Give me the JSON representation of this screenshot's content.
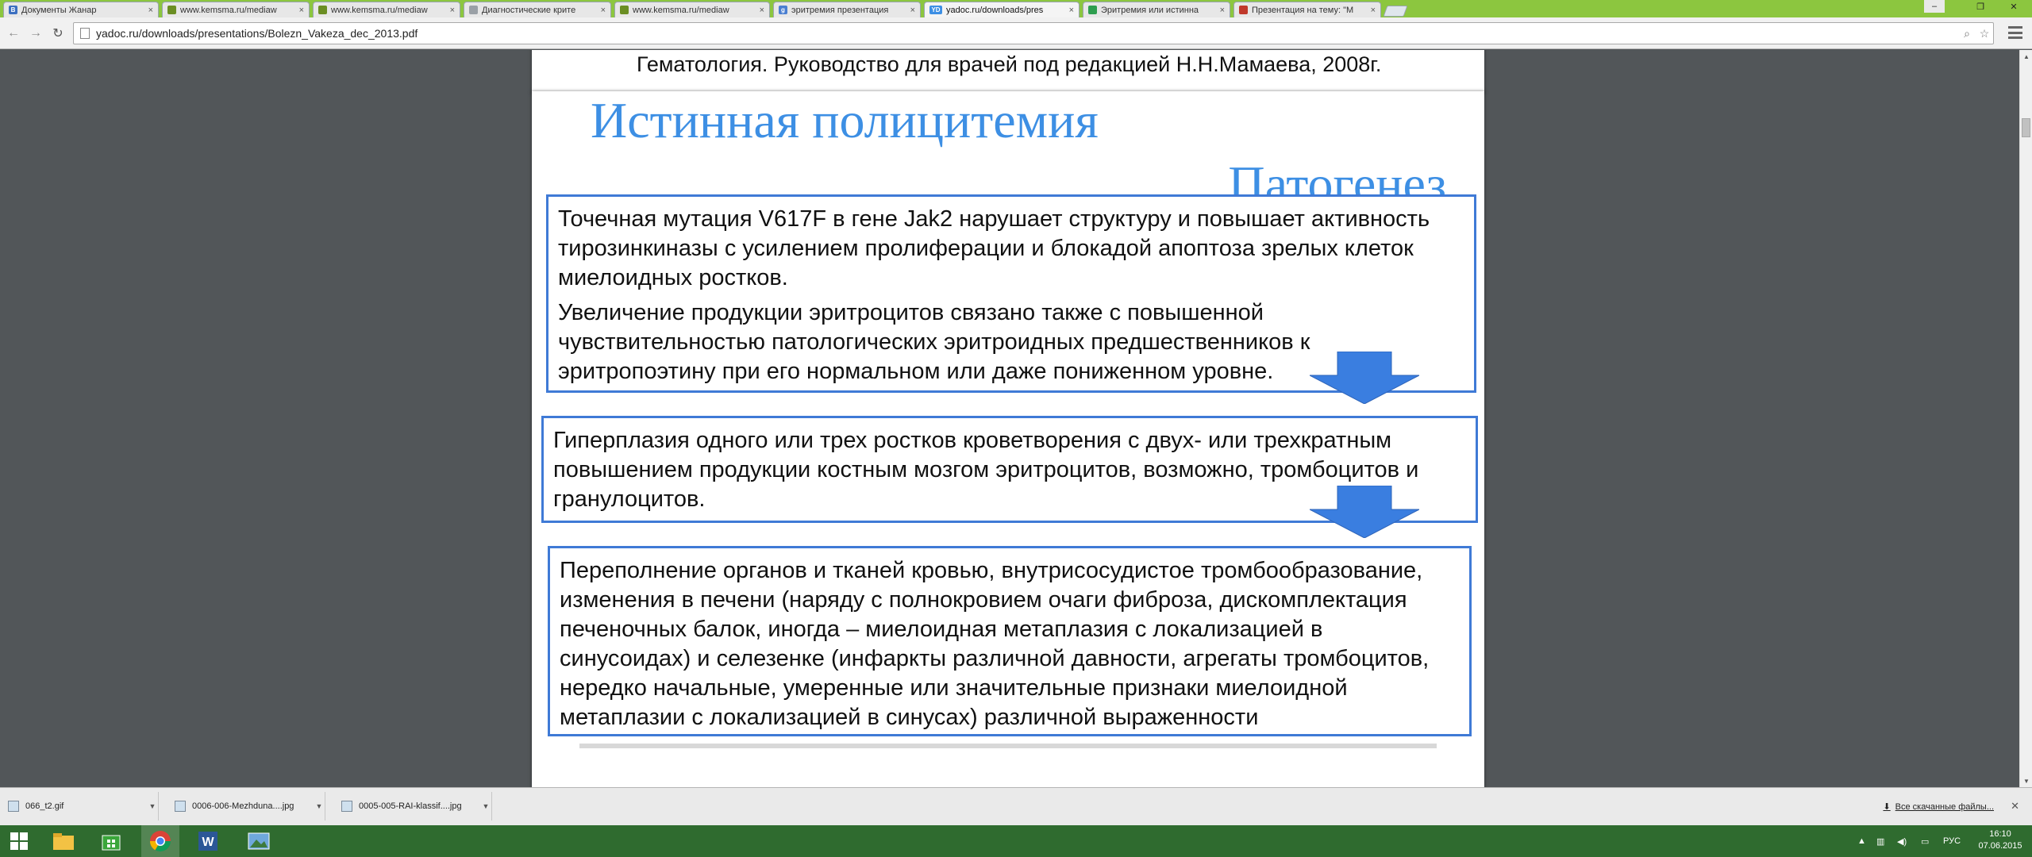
{
  "browser": {
    "tabs": [
      {
        "title": "Документы Жанар",
        "favicon_color": "#3b6fc0",
        "favicon_text": "В",
        "active": false
      },
      {
        "title": "www.kemsma.ru/mediaw",
        "favicon_color": "#6b8e23",
        "favicon_text": "",
        "active": false
      },
      {
        "title": "www.kemsma.ru/mediaw",
        "favicon_color": "#6b8e23",
        "favicon_text": "",
        "active": false
      },
      {
        "title": "Диагностические крите",
        "favicon_color": "#9aa0a6",
        "favicon_text": "",
        "active": false
      },
      {
        "title": "www.kemsma.ru/mediaw",
        "favicon_color": "#6b8e23",
        "favicon_text": "",
        "active": false
      },
      {
        "title": "эритремия презентация",
        "favicon_color": "#4a7fd1",
        "favicon_text": "g",
        "active": false
      },
      {
        "title": "yadoc.ru/downloads/pres",
        "favicon_color": "#3d8fe4",
        "favicon_text": "YD",
        "active": true
      },
      {
        "title": "Эритремия или истинна",
        "favicon_color": "#2e9e4f",
        "favicon_text": "",
        "active": false
      },
      {
        "title": "Презентация на тему: \"М",
        "favicon_color": "#c0392b",
        "favicon_text": "",
        "active": false
      }
    ],
    "tab_close_glyph": "×",
    "window_controls": {
      "minimize": "‒",
      "restore": "❐",
      "close": "✕"
    },
    "nav": {
      "back": "←",
      "forward": "→",
      "reload": "↻"
    },
    "url": "yadoc.ru/downloads/presentations/Bolezn_Vakeza_dec_2013.pdf",
    "omnibox_icons": {
      "zoom": "⌕",
      "bookmark": "☆"
    }
  },
  "pdf": {
    "prev_page_reference": "Гематология. Руководство для врачей под редакцией Н.Н.Мамаева, 2008г.",
    "slide": {
      "title": "Истинная полицитемия",
      "subtitle": "Патогенез",
      "box1": {
        "p1": "Точечная мутация V617F в гене Jak2 нарушает структуру и повышает активность тирозинкиназы с усилением пролиферации и блокадой апоптоза зрелых клеток миелоидных ростков.",
        "p2": "Увеличение продукции эритроцитов связано также с повышенной чувствительностью патологических эритроидных предшественников к эритропоэтину при его нормальном или даже пониженном уровне."
      },
      "box2": "Гиперплазия одного или трех ростков кроветворения с двух- или трехкратным повышением продукции костным мозгом эритроцитов, возможно, тромбоцитов и гранулоцитов.",
      "box3": "Переполнение органов и тканей кровью, внутрисосудистое тромбообразование, изменения в печени (наряду с полнокровием очаги фиброза, дискомплектация печеночных балок, иногда – миелоидная метаплазия с локализацией в синусоидах) и селезенке (инфаркты различной давности, агрегаты тромбоцитов, нередко начальные, умеренные или значительные признаки миелоидной метаплазии с локализацией в синусах) различной выраженности",
      "colors": {
        "heading": "#3d8fe4",
        "box_border": "#3f7ad6",
        "arrow": "#3a7ee0"
      }
    }
  },
  "downloads": {
    "items": [
      "066_t2.gif",
      "0006-006-Mezhduna....jpg",
      "0005-005-RAI-klassif....jpg"
    ],
    "show_all": "Все скачанные файлы...",
    "close": "✕"
  },
  "taskbar": {
    "language": "РУС",
    "time": "16:10",
    "date": "07.06.2015"
  }
}
